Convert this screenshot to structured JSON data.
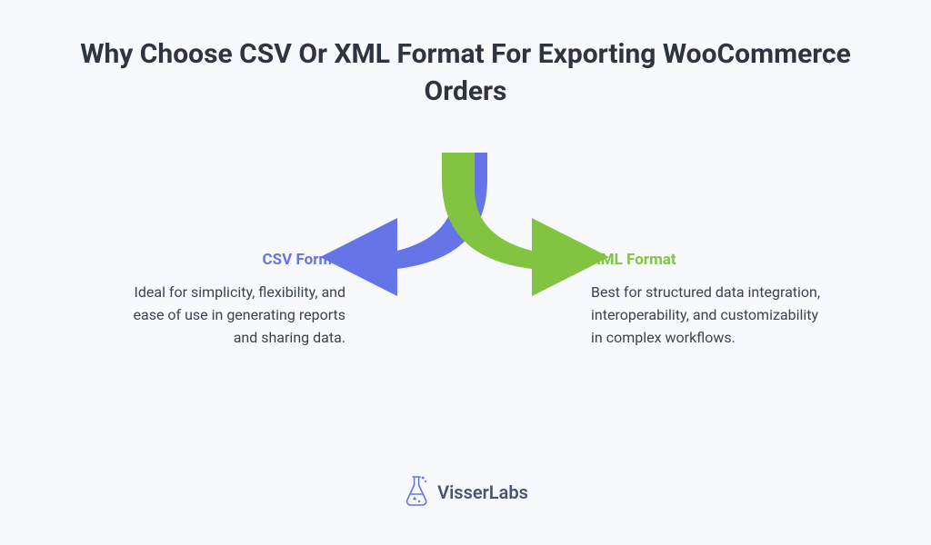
{
  "title": "Why Choose CSV Or XML Format For Exporting WooCommerce Orders",
  "left": {
    "heading": "CSV Format",
    "description": "Ideal for simplicity, flexibility, and ease of use in generating reports and sharing data.",
    "color": "#6574e6"
  },
  "right": {
    "heading": "XML Format",
    "description": "Best for structured data integration, interoperability, and customizability in complex workflows.",
    "color": "#82c341"
  },
  "brand": "VisserLabs"
}
